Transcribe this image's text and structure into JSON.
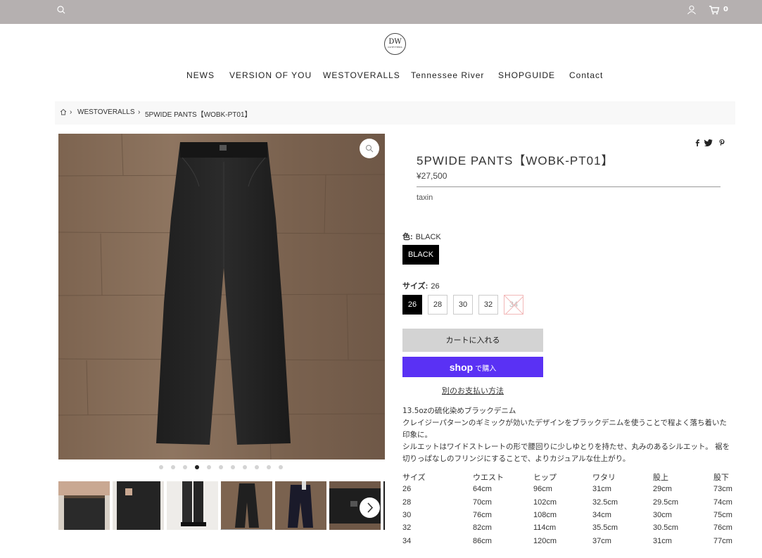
{
  "header": {
    "cart_count": "0",
    "logo_main": "DW",
    "logo_sub": "OUTFITTERS"
  },
  "nav": [
    "NEWS",
    "VERSION OF YOU",
    "WESTOVERALLS",
    "Tennessee River",
    "SHOPGUIDE",
    "Contact"
  ],
  "breadcrumb": [
    "WESTOVERALLS",
    "5PWIDE PANTS【WOBK-PT01】"
  ],
  "product": {
    "title": "5PWIDE PANTS【WOBK-PT01】",
    "price": "¥27,500",
    "tax_note": "taxin",
    "color_label": "色:",
    "color_value": "BLACK",
    "colors": [
      "BLACK"
    ],
    "size_label": "サイズ:",
    "size_value": "26",
    "sizes": [
      "26",
      "28",
      "30",
      "32",
      "34"
    ],
    "add_to_cart": "カートに入れる",
    "shop_pay_brand": "shop",
    "shop_pay_suffix": "で購入",
    "other_payment": "別のお支払い方法"
  },
  "gallery": {
    "image_count": 11,
    "active_index": 3
  },
  "description": [
    "13.5ozの硫化染めブラックデニム",
    "クレイジーパターンのギミックが効いたデザインをブラックデニムを使うことで程よく落ち着いた",
    "印象に。",
    "シルエットはワイドストレートの形で腰回りに少しゆとりを持たせ、丸みのあるシルエット。 裾を",
    "切りっぱなしのフリンジにすることで、よりカジュアルな仕上がり。"
  ],
  "size_table": {
    "headers": [
      "サイズ",
      "ウエスト",
      "ヒップ",
      "ワタリ",
      "股上",
      "股下"
    ],
    "rows": [
      [
        "26",
        "64cm",
        "96cm",
        "31cm",
        "29cm",
        "73cm"
      ],
      [
        "28",
        "70cm",
        "102cm",
        "32.5cm",
        "29.5cm",
        "74cm"
      ],
      [
        "30",
        "76cm",
        "108cm",
        "34cm",
        "30cm",
        "75cm"
      ],
      [
        "32",
        "82cm",
        "114cm",
        "35.5cm",
        "30.5cm",
        "76cm"
      ],
      [
        "34",
        "86cm",
        "120cm",
        "37cm",
        "31cm",
        "77cm"
      ]
    ]
  },
  "colors": {
    "topbar": "#b5b0b0",
    "shop_pay": "#5a31f4",
    "swatch_selected": "#000000",
    "button_cart": "#d3d3d3"
  },
  "icons": [
    "search-icon",
    "user-icon",
    "cart-icon",
    "home-icon",
    "zoom-icon",
    "facebook-icon",
    "twitter-icon",
    "pinterest-icon",
    "chevron-right-icon"
  ]
}
